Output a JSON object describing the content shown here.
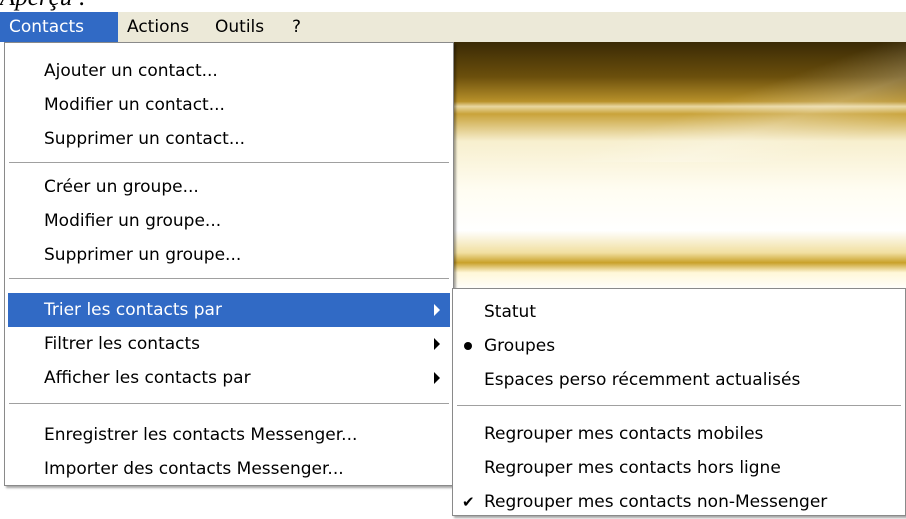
{
  "caption": "Aperçu :",
  "menubar": {
    "items": [
      {
        "label": "Contacts",
        "active": true
      },
      {
        "label": "Actions"
      },
      {
        "label": "Outils"
      },
      {
        "label": "?"
      }
    ]
  },
  "contacts_menu": {
    "groups": [
      [
        "Ajouter un contact...",
        "Modifier un contact...",
        "Supprimer un contact..."
      ],
      [
        "Créer un groupe...",
        "Modifier un groupe...",
        "Supprimer un groupe..."
      ],
      [
        "Trier les contacts par",
        "Filtrer les contacts",
        "Afficher les contacts par"
      ],
      [
        "Enregistrer les contacts Messenger...",
        "Importer des contacts Messenger..."
      ]
    ],
    "highlighted": "Trier les contacts par"
  },
  "sort_submenu": {
    "groups": [
      [
        "Statut",
        "Groupes",
        "Espaces perso récemment actualisés"
      ],
      [
        "Regrouper mes contacts mobiles",
        "Regrouper mes contacts hors ligne",
        "Regrouper mes contacts non-Messenger"
      ]
    ],
    "selected_radio": "Groupes",
    "checked": "Regrouper mes contacts non-Messenger"
  },
  "colors": {
    "highlight": "#316ac5",
    "menubar": "#ece9d8"
  }
}
